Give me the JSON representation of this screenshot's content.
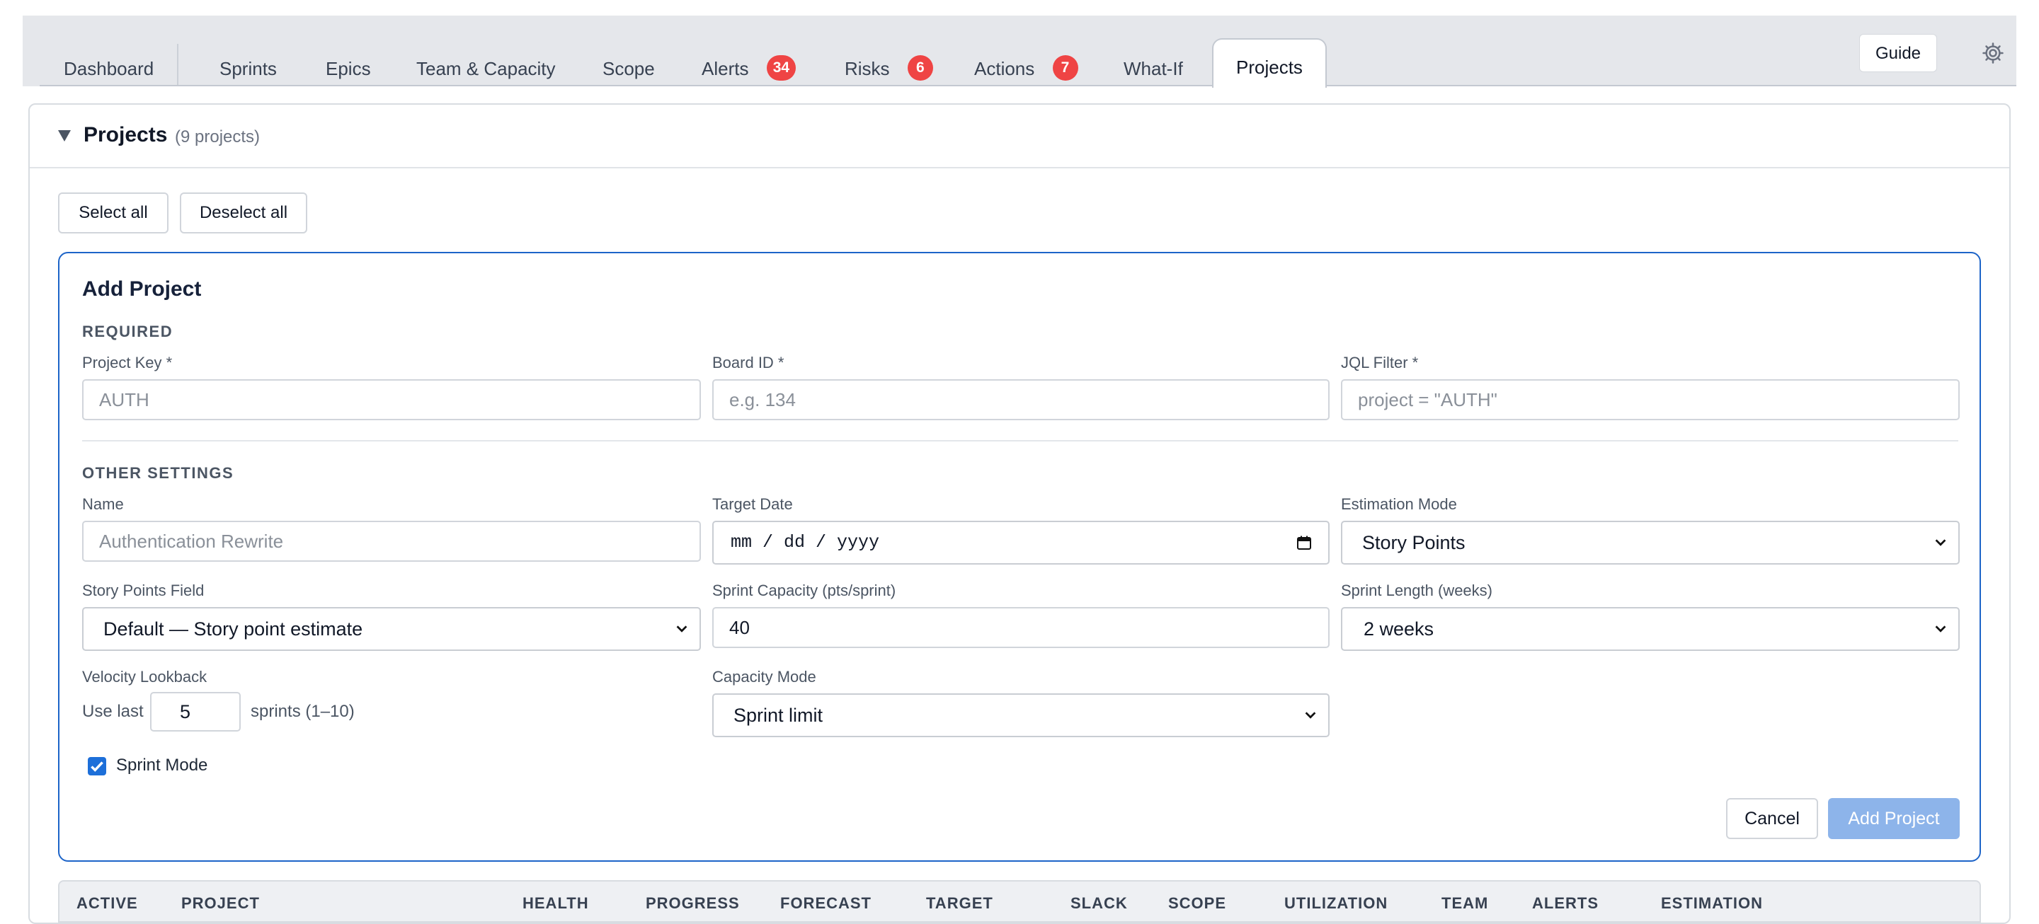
{
  "tabs": [
    {
      "label": "Dashboard",
      "badge": ""
    },
    {
      "label": "Sprints",
      "badge": ""
    },
    {
      "label": "Epics",
      "badge": ""
    },
    {
      "label": "Team & Capacity",
      "badge": ""
    },
    {
      "label": "Scope",
      "badge": ""
    },
    {
      "label": "Alerts",
      "badge": "34"
    },
    {
      "label": "Risks",
      "badge": "6"
    },
    {
      "label": "Actions",
      "badge": "7"
    },
    {
      "label": "What-If",
      "badge": ""
    },
    {
      "label": "Projects",
      "badge": "",
      "active": true
    }
  ],
  "header": {
    "guide_label": "Guide",
    "settings_icon": "gear-icon"
  },
  "panel": {
    "title": "Projects",
    "count": "(9 projects)",
    "select_all": "Select all",
    "deselect_all": "Deselect all"
  },
  "form": {
    "title": "Add Project",
    "required_section": "REQUIRED",
    "other_section": "OTHER SETTINGS",
    "project_key": {
      "label": "Project Key *",
      "placeholder": "AUTH"
    },
    "board_id": {
      "label": "Board ID *",
      "placeholder": "e.g. 134"
    },
    "jql_filter": {
      "label": "JQL Filter *",
      "placeholder": "project = \"AUTH\""
    },
    "name": {
      "label": "Name",
      "placeholder": "Authentication Rewrite"
    },
    "target_date": {
      "label": "Target Date",
      "placeholder": "mm / dd / yyyy"
    },
    "estimation_mode": {
      "label": "Estimation Mode",
      "value": "Story Points"
    },
    "story_points_field": {
      "label": "Story Points Field",
      "value": "Default — Story point estimate"
    },
    "sprint_capacity": {
      "label": "Sprint Capacity (pts/sprint)",
      "value": "40"
    },
    "sprint_length": {
      "label": "Sprint Length (weeks)",
      "value": "2 weeks"
    },
    "velocity_lookback": {
      "label": "Velocity Lookback",
      "prefix": "Use last",
      "value": "5",
      "suffix": "sprints (1–10)"
    },
    "capacity_mode": {
      "label": "Capacity Mode",
      "value": "Sprint limit"
    },
    "sprint_mode": {
      "label": "Sprint Mode",
      "checked": true
    },
    "cancel_label": "Cancel",
    "submit_label": "Add Project"
  },
  "table": {
    "columns": [
      "ACTIVE",
      "PROJECT",
      "HEALTH",
      "PROGRESS",
      "FORECAST",
      "TARGET",
      "SLACK",
      "SCOPE",
      "UTILIZATION",
      "TEAM",
      "ALERTS",
      "ESTIMATION"
    ]
  },
  "colors": {
    "accent": "#1d64c8",
    "badge": "#ef4444",
    "submit_disabled": "#8db4ea"
  }
}
